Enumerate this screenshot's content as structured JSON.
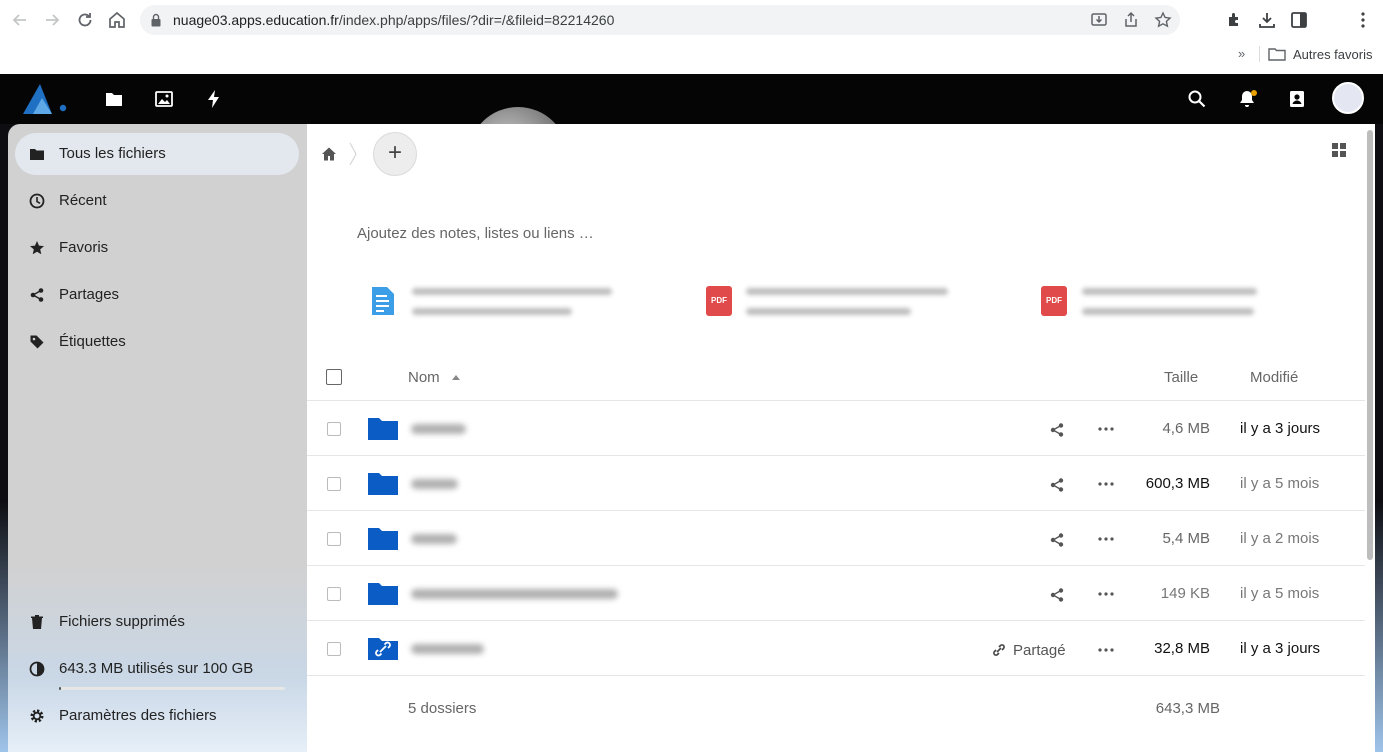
{
  "browser": {
    "url_host": "nuage03.apps.education.fr",
    "url_path": "/index.php/apps/files/?dir=/&fileid=82214260",
    "bookmarks_more": "»",
    "bookmark_folder": "Autres favoris"
  },
  "sidebar": {
    "items": [
      {
        "label": "Tous les fichiers",
        "icon": "folder-icon",
        "active": true
      },
      {
        "label": "Récent",
        "icon": "clock-icon"
      },
      {
        "label": "Favoris",
        "icon": "star-icon"
      },
      {
        "label": "Partages",
        "icon": "share-icon"
      },
      {
        "label": "Étiquettes",
        "icon": "tag-icon"
      }
    ],
    "footer": {
      "trash": "Fichiers supprimés",
      "quota": "643.3 MB utilisés sur 100 GB",
      "quota_fraction": 0.0064,
      "settings": "Paramètres des fichiers"
    }
  },
  "main": {
    "new_button": "+",
    "rich_workspace_placeholder": "Ajoutez des notes, listes ou liens …",
    "recent_files": [
      {
        "icon": "text-document-icon"
      },
      {
        "icon": "pdf-icon",
        "icon_label": "PDF"
      },
      {
        "icon": "pdf-icon",
        "icon_label": "PDF"
      }
    ],
    "table": {
      "headers": {
        "name": "Nom",
        "size": "Taille",
        "modified": "Modifié"
      },
      "rows": [
        {
          "size": "4,6 MB",
          "modified": "il y a 3 jours",
          "shared": false
        },
        {
          "size": "600,3 MB",
          "modified": "il y a 5 mois",
          "shared": false
        },
        {
          "size": "5,4 MB",
          "modified": "il y a 2 mois",
          "shared": false
        },
        {
          "size": "149 KB",
          "modified": "il y a 5 mois",
          "shared": false
        },
        {
          "size": "32,8 MB",
          "modified": "il y a 3 jours",
          "shared": true,
          "shared_label": "Partagé"
        }
      ],
      "summary": {
        "count": "5 dossiers",
        "total_size": "643,3 MB"
      }
    }
  },
  "colors": {
    "folder": "#0b5cc4",
    "header_bg": "#050505",
    "sidebar_bg": "#d1d1d1",
    "active_item_bg": "#e3e8ef",
    "pdf": "#e04a4a",
    "text_doc": "#3d9ee8"
  }
}
